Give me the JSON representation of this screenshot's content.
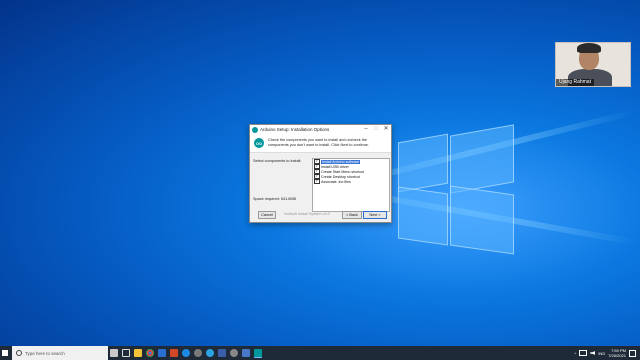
{
  "webcam": {
    "name": "Ujang Rahmat"
  },
  "dialog": {
    "title": "Arduino Setup: Installation Options",
    "header_text": "Check the components you want to install and uncheck the components you don't want to install. Click Next to continue.",
    "icon_text": "OO",
    "select_label": "Select components to install:",
    "space_label": "Space required: 541.6MB",
    "components": [
      {
        "label": "Install Arduino software",
        "checked": true,
        "selected": true
      },
      {
        "label": "Install USB driver",
        "checked": true,
        "selected": false
      },
      {
        "label": "Create Start Menu shortcut",
        "checked": true,
        "selected": false
      },
      {
        "label": "Create Desktop shortcut",
        "checked": true,
        "selected": false
      },
      {
        "label": "Associate .ino files",
        "checked": true,
        "selected": false
      }
    ],
    "cancel_label": "Cancel",
    "nullsoft_label": "Nullsoft Install System v3.0",
    "back_label": "< Back",
    "next_label": "Next >",
    "check_glyph": "✓",
    "minimize_glyph": "–",
    "maximize_glyph": "□",
    "close_glyph": "✕"
  },
  "taskbar": {
    "search_placeholder": "Type here to search",
    "tray_lang": "IND",
    "time": "7:50 PM",
    "date": "7/26/2021",
    "tray_arrow": "^"
  }
}
